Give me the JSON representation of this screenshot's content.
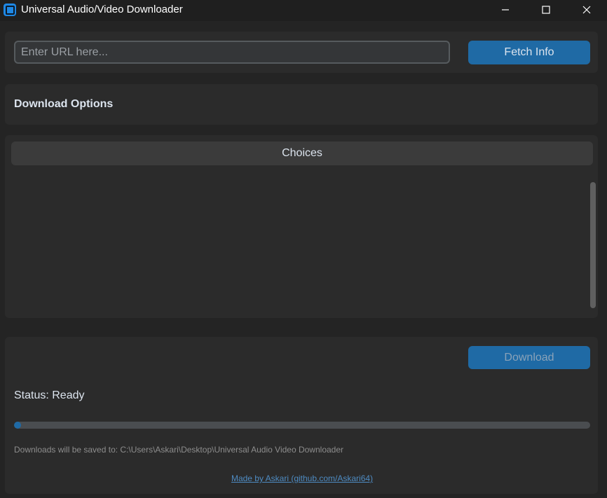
{
  "window": {
    "title": "Universal Audio/Video Downloader",
    "icon": "app-icon",
    "controls": {
      "minimize": "minimize-icon",
      "maximize": "maximize-icon",
      "close": "close-icon"
    }
  },
  "url_section": {
    "input_value": "",
    "input_placeholder": "Enter URL here...",
    "fetch_label": "Fetch Info"
  },
  "options": {
    "heading": "Download Options"
  },
  "choices": {
    "header": "Choices",
    "items": []
  },
  "bottom": {
    "download_label": "Download",
    "status": "Status: Ready",
    "progress": 0.01,
    "save_path_text": "Downloads will be saved to: C:\\Users\\Askari\\Desktop\\Universal Audio Video Downloader",
    "credit_text": "Made by Askari (github.com/Askari64)"
  },
  "colors": {
    "background": "#242424",
    "frame": "#2b2b2b",
    "accent": "#1f6aa5",
    "link": "#4e8bc2"
  }
}
